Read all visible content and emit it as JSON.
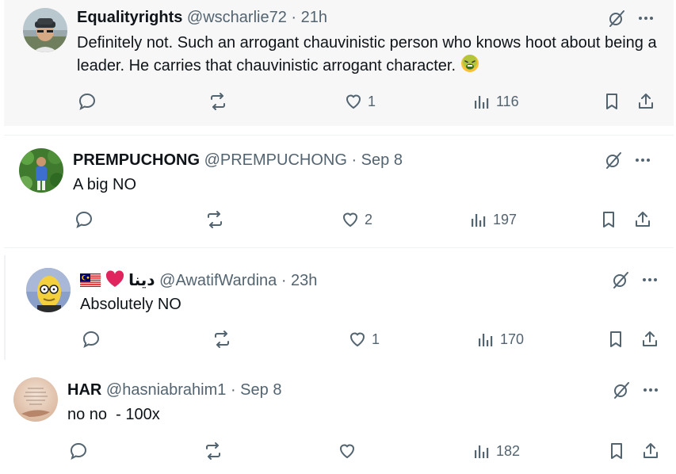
{
  "replies": [
    {
      "name": "Equalityrights",
      "handle": "@wscharlie72",
      "time": "· 21h",
      "text": "Definitely not. Such an arrogant chauvinistic person who knows hoot about being a leader. He carries that chauvinistic arrogant character.",
      "emoji": "nauseated-face",
      "likes": "1",
      "views": "116"
    },
    {
      "name": "PREMPUCHONG",
      "handle": "@PREMPUCHONG",
      "time": "· Sep 8",
      "text": "A big NO",
      "likes": "2",
      "views": "197"
    },
    {
      "name": "دينا",
      "name_prefix_icons": [
        "malaysia-flag",
        "red-heart"
      ],
      "handle": "@AwatifWardina",
      "time": "· 23h",
      "text": "Absolutely NO",
      "likes": "1",
      "views": "170"
    },
    {
      "name": "HAR",
      "handle": "@hasniabrahim1",
      "time": "· Sep 8",
      "text": "no no  - 100x",
      "likes": "",
      "views": "182",
      "avatar_text": "Ya Allah! Grant me a mind free of worry, a heart free of sadness, and a body free of sickness."
    }
  ],
  "colors": {
    "text": "#0f1419",
    "secondary": "#536471",
    "highlight_bg": "#f7f7f7",
    "heart_red": "#e0245e"
  }
}
